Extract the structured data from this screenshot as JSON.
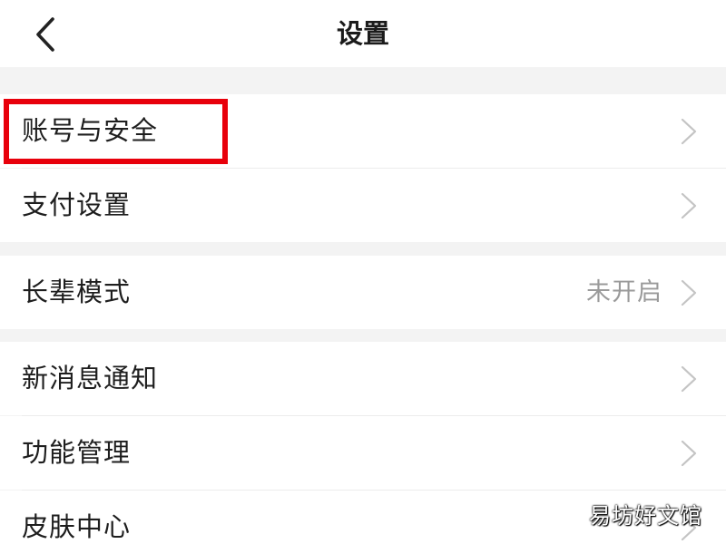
{
  "header": {
    "title": "设置",
    "back_icon": "chevron-left-icon"
  },
  "sections": [
    {
      "items": [
        {
          "label": "账号与安全",
          "value": "",
          "highlighted": true
        },
        {
          "label": "支付设置",
          "value": ""
        }
      ]
    },
    {
      "items": [
        {
          "label": "长辈模式",
          "value": "未开启"
        }
      ]
    },
    {
      "items": [
        {
          "label": "新消息通知",
          "value": ""
        },
        {
          "label": "功能管理",
          "value": ""
        },
        {
          "label": "皮肤中心",
          "value": ""
        }
      ]
    }
  ],
  "watermark": "易坊好文馆",
  "colors": {
    "background": "#f3f3f3",
    "row_background": "#ffffff",
    "text": "#1e1e1e",
    "secondary_text": "#9a9a9a",
    "chevron": "#c4c4c4",
    "highlight": "#e8000b"
  }
}
